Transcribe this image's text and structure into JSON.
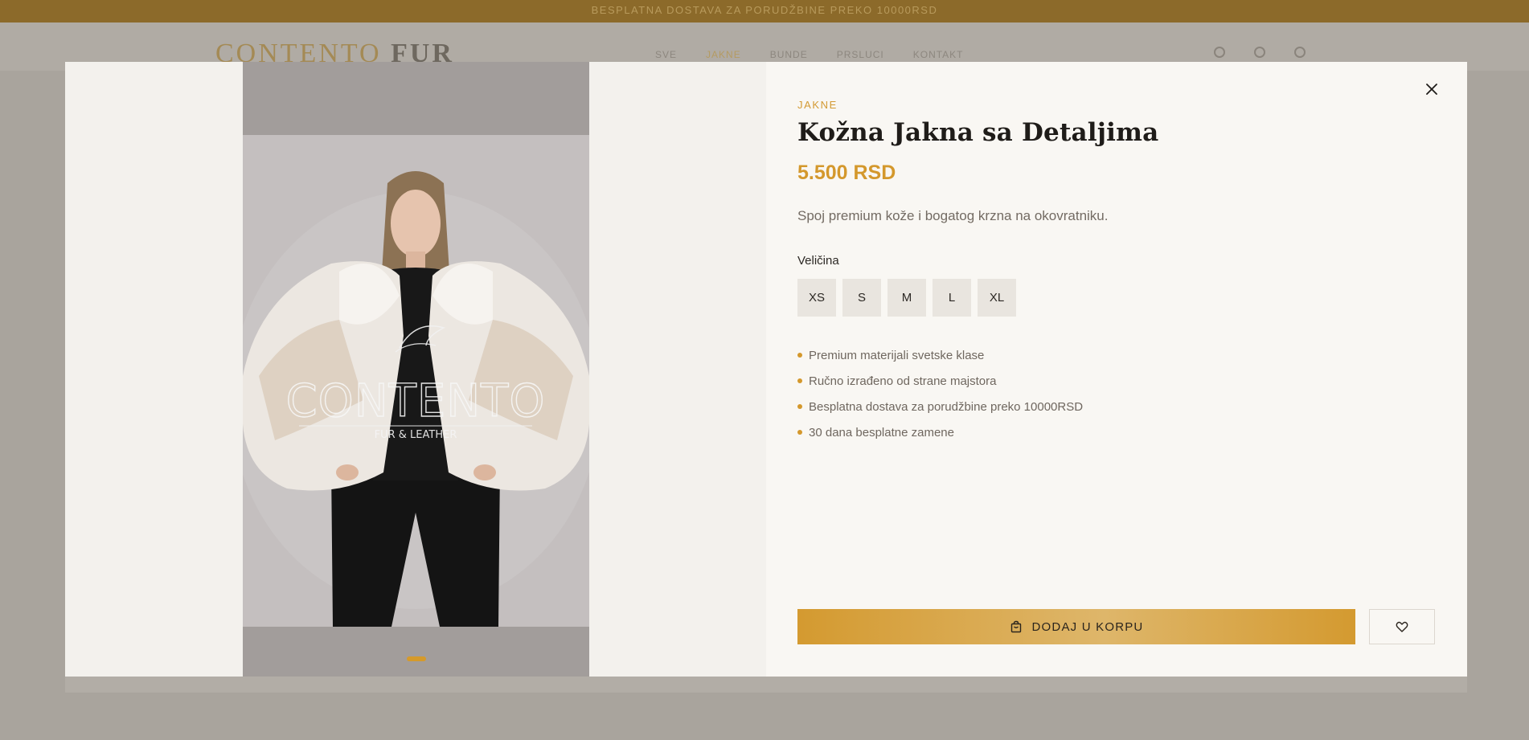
{
  "background_page": {
    "announcement": "BESPLATNA DOSTAVA ZA PORUDŽBINE PREKO 10000RSD",
    "logo_gold": "CONTENTO",
    "logo_dark": " FUR",
    "nav": [
      "SVE",
      "JAKNE",
      "BUNDE",
      "PRSLUCI",
      "KONTAKT"
    ],
    "active_nav": "JAKNE"
  },
  "product": {
    "category": "JAKNE",
    "title": "Kožna Jakna sa Detaljima",
    "price": "5.500 RSD",
    "description": "Spoj premium kože i bogatog krzna na okovratniku.",
    "size_label": "Veličina",
    "sizes": [
      "XS",
      "S",
      "M",
      "L",
      "XL"
    ],
    "features": [
      "Premium materijali svetske klase",
      "Ručno izrađeno od strane majstora",
      "Besplatna dostava za porudžbine preko 10000RSD",
      "30 dana besplatne zamene"
    ],
    "add_to_cart_label": "DODAJ U KORPU",
    "watermark_brand": "CONTENTO",
    "watermark_tagline": "FUR & LEATHER"
  },
  "icons": {
    "close": "close-icon",
    "cart": "shopping-bag-icon",
    "wishlist": "heart-icon"
  },
  "colors": {
    "accent": "#d4982c",
    "announcement_bar": "#8c6a2a",
    "overlay": "#a9a49d"
  },
  "gallery": {
    "image_count": 1,
    "active_index": 0
  }
}
